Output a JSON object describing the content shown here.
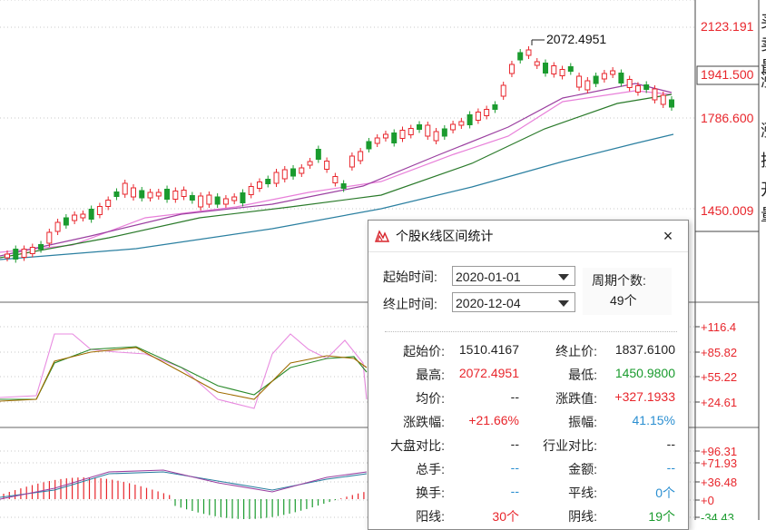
{
  "price_axis": [
    "2123.191",
    "1941.500",
    "1786.600",
    "1450.009"
  ],
  "kdj_axis": [
    "+116.4",
    "+85.82",
    "+55.22",
    "+24.61"
  ],
  "macd_axis": [
    "+96.31",
    "+71.93",
    "+36.48",
    "+0",
    "-34.43"
  ],
  "peak_label": "2072.4951",
  "right_panel_chars": [
    "买",
    "卖",
    "最",
    "涨",
    "涨",
    "换",
    "开",
    "量"
  ],
  "colors": {
    "up": "#e8262c",
    "down": "#1a9b2e",
    "ma5": "#555555",
    "ma10": "#9b3fa0",
    "ma20": "#e87fd9",
    "ma30": "#2a7a2a",
    "ma60": "#2a7fa0"
  },
  "dialog": {
    "title": "个股K线区间统计",
    "icon": "stock-chart-icon",
    "close": "×",
    "start_label": "起始时间:",
    "start_value": "2020-01-01",
    "end_label": "终止时间:",
    "end_value": "2020-12-04",
    "period_label": "周期个数:",
    "period_value": "49个",
    "rows": [
      {
        "k1": "起始价:",
        "v1": "1510.4167",
        "c1": "dark",
        "k2": "终止价:",
        "v2": "1837.6100",
        "c2": "dark"
      },
      {
        "k1": "最高:",
        "v1": "2072.4951",
        "c1": "red",
        "k2": "最低:",
        "v2": "1450.9800",
        "c2": "green"
      },
      {
        "k1": "均价:",
        "v1": "--",
        "c1": "dark",
        "k2": "涨跌值:",
        "v2": "+327.1933",
        "c2": "red"
      },
      {
        "k1": "涨跌幅:",
        "v1": "+21.66%",
        "c1": "red",
        "k2": "振幅:",
        "v2": "41.15%",
        "c2": "blue"
      },
      {
        "k1": "大盘对比:",
        "v1": "--",
        "c1": "dark",
        "k2": "行业对比:",
        "v2": "--",
        "c2": "dark"
      },
      {
        "k1": "总手:",
        "v1": "--",
        "c1": "blue",
        "k2": "金额:",
        "v2": "--",
        "c2": "blue"
      },
      {
        "k1": "换手:",
        "v1": "--",
        "c1": "blue",
        "k2": "平线:",
        "v2": "0个",
        "c2": "blue"
      },
      {
        "k1": "阳线:",
        "v1": "30个",
        "c1": "red",
        "k2": "阴线:",
        "v2": "19个",
        "c2": "green"
      }
    ]
  }
}
